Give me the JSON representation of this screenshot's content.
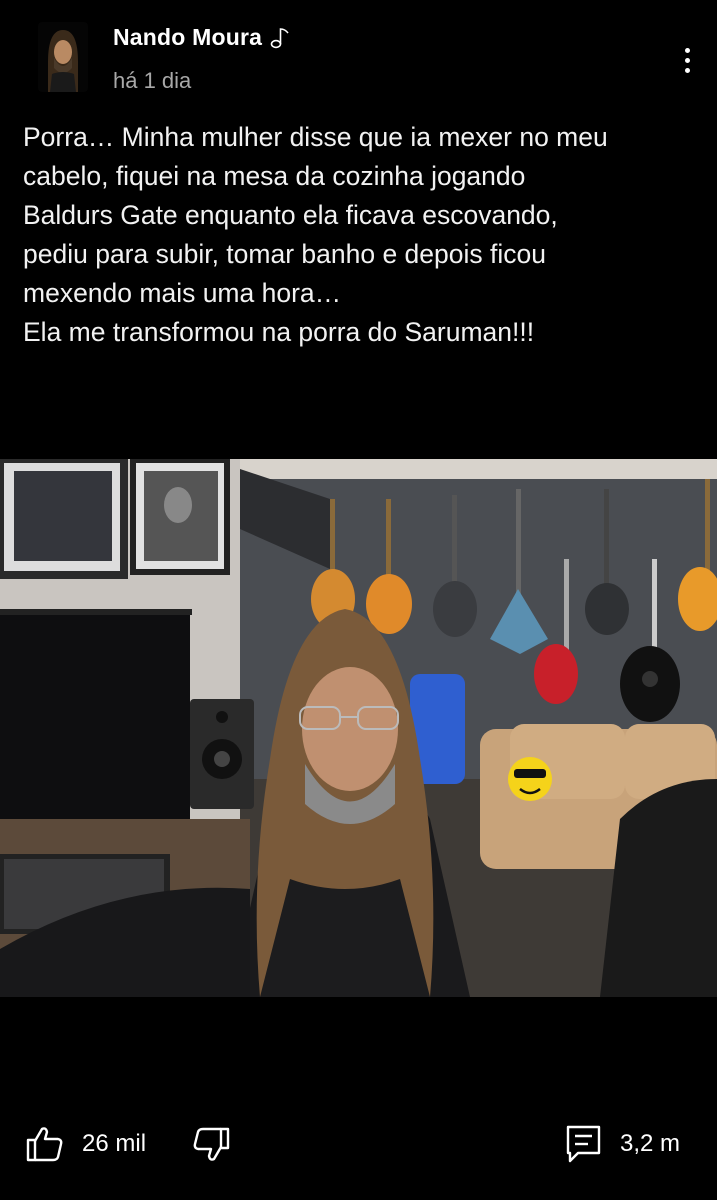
{
  "post": {
    "author": "Nando Moura",
    "time": "há 1 dia",
    "text": "Porra… Minha mulher disse que ia mexer no meu\ncabelo, fiquei na mesa da cozinha jogando\nBaldurs Gate enquanto ela ficava escovando,\npediu para subir, tomar banho e depois ficou\nmexendo mais uma hora…\nEla me transformou na porra do Saruman!!!"
  },
  "actions": {
    "likes": "26 mil",
    "comments": "3,2 m"
  },
  "icons": {
    "author_badge": "music-note-icon",
    "menu": "more-vertical-icon",
    "like": "thumbs-up-icon",
    "dislike": "thumbs-down-icon",
    "comment": "comment-icon"
  },
  "colors": {
    "background": "#000000",
    "text": "#ffffff",
    "secondary_text": "#a8a8a8"
  }
}
